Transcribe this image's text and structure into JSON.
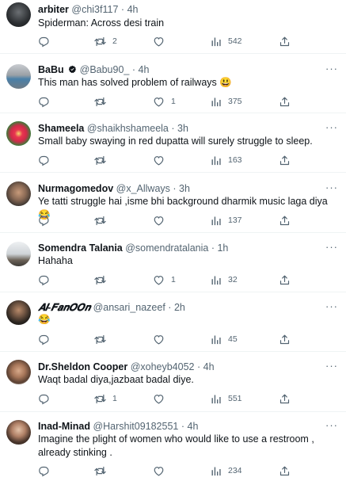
{
  "tweets": [
    {
      "name": "arbiter",
      "handle": "@chi3f117",
      "time": "4h",
      "text": "Spiderman: Across desi train",
      "replies": "",
      "retweets": "2",
      "likes": "",
      "views": "542"
    },
    {
      "name": "BaBu",
      "handle": "@Babu90_",
      "time": "4h",
      "text": "This man has solved problem of railways 😃",
      "replies": "",
      "retweets": "",
      "likes": "1",
      "views": "375"
    },
    {
      "name": "Shameela",
      "handle": "@shaikhshameela",
      "time": "3h",
      "text": "Small baby swaying in red dupatta will surely struggle to sleep.",
      "replies": "",
      "retweets": "",
      "likes": "",
      "views": "163"
    },
    {
      "name": "Nurmagomedov",
      "handle": "@x_Allways",
      "time": "3h",
      "text": "Ye tatti struggle hai ,isme bhi background dharmik music laga diya 😂",
      "replies": "",
      "retweets": "",
      "likes": "",
      "views": "137"
    },
    {
      "name": "Somendra Talania",
      "handle": "@somendratalania",
      "time": "1h",
      "text": "Hahaha",
      "replies": "",
      "retweets": "",
      "likes": "1",
      "views": "32"
    },
    {
      "name": "𝑨𝒍-𝑭𝒂𝒏𝑶𝑶𝒏",
      "handle": "@ansari_nazeef",
      "time": "2h",
      "text": "😂",
      "replies": "",
      "retweets": "",
      "likes": "",
      "views": "45"
    },
    {
      "name": "Dr.Sheldon Cooper",
      "handle": "@xoheyb4052",
      "time": "4h",
      "text": "Waqt badal diya,jazbaat badal diye.",
      "replies": "",
      "retweets": "1",
      "likes": "",
      "views": "551"
    },
    {
      "name": "Inad-Minad",
      "handle": "@Harshit09182551",
      "time": "4h",
      "text": "Imagine the plight of women who would like to  use a restroom , already stinking .",
      "replies": "",
      "retweets": "",
      "likes": "",
      "views": "234"
    }
  ],
  "ui": {
    "dot": "·",
    "more": "···"
  },
  "colors": {
    "secondary": "#536471",
    "text": "#0f1419",
    "divider": "#eff3f4",
    "verified": "#1d9bf0"
  }
}
